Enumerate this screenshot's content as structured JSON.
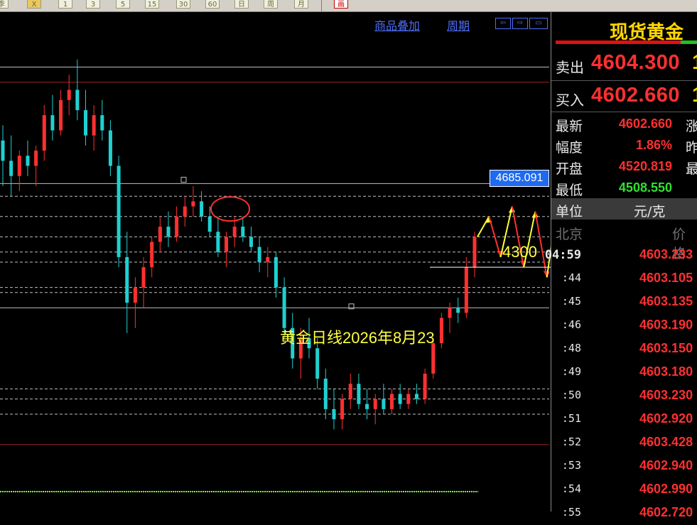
{
  "toolbar": {
    "buttons": [
      {
        "icon": "weekly-icon",
        "label": "季"
      },
      {
        "icon": "x-icon",
        "label": "X"
      },
      {
        "icon": "period-1-icon",
        "label": "1"
      },
      {
        "icon": "period-3-icon",
        "label": "3"
      },
      {
        "icon": "period-5-icon",
        "label": "5"
      },
      {
        "icon": "period-15-icon",
        "label": "15"
      },
      {
        "icon": "period-30-icon",
        "label": "30"
      },
      {
        "icon": "period-60-icon",
        "label": "60"
      },
      {
        "icon": "period-day-icon",
        "label": "日"
      },
      {
        "icon": "period-week-icon",
        "label": "周"
      },
      {
        "icon": "period-month-icon",
        "label": "月"
      },
      {
        "icon": "picture-icon",
        "label": "画"
      }
    ]
  },
  "chart_header": {
    "overlay_link": "商品叠加",
    "period_link": "周期",
    "nav_buttons": [
      "⇦",
      "⇨",
      "▭"
    ]
  },
  "chart_data": {
    "type": "candlestick",
    "title": "",
    "annotation_text": "黄金日线2026年8月23",
    "current_price_tag": "4685.091",
    "support_level_label": "4300",
    "ylim": [
      4100,
      5000
    ],
    "colors": {
      "up": "#ff3030",
      "down": "#20d0d0",
      "projection_up": "#ffff30",
      "projection_down": "#ff3030",
      "highlight_circle": "#ff3030"
    },
    "candles": [
      {
        "o": 4790,
        "h": 4820,
        "l": 4700,
        "c": 4750
      },
      {
        "o": 4750,
        "h": 4800,
        "l": 4680,
        "c": 4720
      },
      {
        "o": 4720,
        "h": 4770,
        "l": 4690,
        "c": 4760
      },
      {
        "o": 4760,
        "h": 4790,
        "l": 4720,
        "c": 4740
      },
      {
        "o": 4740,
        "h": 4780,
        "l": 4700,
        "c": 4770
      },
      {
        "o": 4770,
        "h": 4860,
        "l": 4750,
        "c": 4840
      },
      {
        "o": 4840,
        "h": 4880,
        "l": 4790,
        "c": 4810
      },
      {
        "o": 4810,
        "h": 4890,
        "l": 4800,
        "c": 4870
      },
      {
        "o": 4870,
        "h": 4920,
        "l": 4840,
        "c": 4890
      },
      {
        "o": 4890,
        "h": 4950,
        "l": 4830,
        "c": 4850
      },
      {
        "o": 4850,
        "h": 4890,
        "l": 4780,
        "c": 4800
      },
      {
        "o": 4800,
        "h": 4860,
        "l": 4770,
        "c": 4840
      },
      {
        "o": 4840,
        "h": 4870,
        "l": 4790,
        "c": 4810
      },
      {
        "o": 4810,
        "h": 4830,
        "l": 4720,
        "c": 4740
      },
      {
        "o": 4740,
        "h": 4760,
        "l": 4540,
        "c": 4560
      },
      {
        "o": 4560,
        "h": 4610,
        "l": 4410,
        "c": 4470
      },
      {
        "o": 4470,
        "h": 4520,
        "l": 4420,
        "c": 4500
      },
      {
        "o": 4500,
        "h": 4560,
        "l": 4460,
        "c": 4540
      },
      {
        "o": 4540,
        "h": 4600,
        "l": 4520,
        "c": 4590
      },
      {
        "o": 4590,
        "h": 4640,
        "l": 4570,
        "c": 4620
      },
      {
        "o": 4620,
        "h": 4650,
        "l": 4580,
        "c": 4600
      },
      {
        "o": 4600,
        "h": 4660,
        "l": 4590,
        "c": 4640
      },
      {
        "o": 4640,
        "h": 4680,
        "l": 4620,
        "c": 4660
      },
      {
        "o": 4660,
        "h": 4700,
        "l": 4640,
        "c": 4670
      },
      {
        "o": 4670,
        "h": 4690,
        "l": 4630,
        "c": 4640
      },
      {
        "o": 4640,
        "h": 4660,
        "l": 4600,
        "c": 4610
      },
      {
        "o": 4610,
        "h": 4640,
        "l": 4560,
        "c": 4570
      },
      {
        "o": 4570,
        "h": 4610,
        "l": 4540,
        "c": 4600
      },
      {
        "o": 4600,
        "h": 4640,
        "l": 4580,
        "c": 4620
      },
      {
        "o": 4620,
        "h": 4640,
        "l": 4590,
        "c": 4600
      },
      {
        "o": 4600,
        "h": 4620,
        "l": 4570,
        "c": 4580
      },
      {
        "o": 4580,
        "h": 4600,
        "l": 4530,
        "c": 4550
      },
      {
        "o": 4550,
        "h": 4580,
        "l": 4520,
        "c": 4560
      },
      {
        "o": 4560,
        "h": 4570,
        "l": 4480,
        "c": 4500
      },
      {
        "o": 4500,
        "h": 4520,
        "l": 4400,
        "c": 4420
      },
      {
        "o": 4420,
        "h": 4450,
        "l": 4340,
        "c": 4360
      },
      {
        "o": 4360,
        "h": 4420,
        "l": 4320,
        "c": 4400
      },
      {
        "o": 4400,
        "h": 4440,
        "l": 4360,
        "c": 4380
      },
      {
        "o": 4380,
        "h": 4400,
        "l": 4300,
        "c": 4320
      },
      {
        "o": 4320,
        "h": 4340,
        "l": 4240,
        "c": 4260
      },
      {
        "o": 4260,
        "h": 4300,
        "l": 4220,
        "c": 4240
      },
      {
        "o": 4240,
        "h": 4290,
        "l": 4220,
        "c": 4280
      },
      {
        "o": 4280,
        "h": 4330,
        "l": 4260,
        "c": 4310
      },
      {
        "o": 4310,
        "h": 4330,
        "l": 4260,
        "c": 4270
      },
      {
        "o": 4270,
        "h": 4300,
        "l": 4240,
        "c": 4260
      },
      {
        "o": 4260,
        "h": 4290,
        "l": 4230,
        "c": 4280
      },
      {
        "o": 4280,
        "h": 4310,
        "l": 4250,
        "c": 4260
      },
      {
        "o": 4260,
        "h": 4300,
        "l": 4250,
        "c": 4290
      },
      {
        "o": 4290,
        "h": 4310,
        "l": 4260,
        "c": 4270
      },
      {
        "o": 4270,
        "h": 4300,
        "l": 4260,
        "c": 4290
      },
      {
        "o": 4290,
        "h": 4310,
        "l": 4270,
        "c": 4280
      },
      {
        "o": 4280,
        "h": 4340,
        "l": 4270,
        "c": 4330
      },
      {
        "o": 4330,
        "h": 4400,
        "l": 4320,
        "c": 4390
      },
      {
        "o": 4390,
        "h": 4450,
        "l": 4380,
        "c": 4440
      },
      {
        "o": 4440,
        "h": 4470,
        "l": 4410,
        "c": 4460
      },
      {
        "o": 4460,
        "h": 4480,
        "l": 4430,
        "c": 4450
      },
      {
        "o": 4450,
        "h": 4560,
        "l": 4440,
        "c": 4540
      },
      {
        "o": 4540,
        "h": 4610,
        "l": 4520,
        "c": 4600
      }
    ],
    "projection_path": [
      4600,
      4640,
      4560,
      4660,
      4540,
      4650,
      4520,
      4680
    ],
    "horizontal_levels": [
      {
        "value": 4935,
        "style": "solid",
        "color": "#c0c0c0"
      },
      {
        "value": 4905,
        "style": "solid",
        "color": "#a02020"
      },
      {
        "value": 4705,
        "style": "solid",
        "color": "#c0c0c0"
      },
      {
        "value": 4680,
        "style": "dashed",
        "color": "#c0c0c0"
      },
      {
        "value": 4640,
        "style": "dashed",
        "color": "#c0c0c0"
      },
      {
        "value": 4600,
        "style": "dashed",
        "color": "#c0c0c0"
      },
      {
        "value": 4570,
        "style": "dashed",
        "color": "#c0c0c0"
      },
      {
        "value": 4550,
        "style": "dashed",
        "color": "#c0c0c0"
      },
      {
        "value": 4500,
        "style": "dashed",
        "color": "#c0c0c0"
      },
      {
        "value": 4490,
        "style": "dashed",
        "color": "#c0c0c0"
      },
      {
        "value": 4460,
        "style": "solid",
        "color": "#c0c0c0"
      },
      {
        "value": 4300,
        "style": "dashed",
        "color": "#c0c0c0"
      },
      {
        "value": 4280,
        "style": "dashed",
        "color": "#c0c0c0"
      },
      {
        "value": 4250,
        "style": "dashed",
        "color": "#c0c0c0"
      },
      {
        "value": 4190,
        "style": "solid",
        "color": "#a02020"
      }
    ]
  },
  "right_panel": {
    "title": "现货黄金",
    "sell": {
      "label": "卖出",
      "value": "4604.300",
      "tail": "1"
    },
    "buy": {
      "label": "买入",
      "value": "4602.660",
      "tail": "1"
    },
    "stats": [
      {
        "label": "最新",
        "value": "4602.660",
        "color": "#ff3030",
        "label2": "涨"
      },
      {
        "label": "幅度",
        "value": "1.86%",
        "color": "#ff3030",
        "label2": "昨"
      },
      {
        "label": "开盘",
        "value": "4520.819",
        "color": "#ff3030",
        "label2": "最"
      },
      {
        "label": "最低",
        "value": "4508.550",
        "color": "#30e030",
        "label2": ""
      }
    ],
    "unit": {
      "label": "单位",
      "value": "元/克"
    },
    "ticks_header": {
      "location": "北京",
      "price": "价格"
    },
    "ticks": [
      {
        "time": "04:59",
        "price": "4603.233"
      },
      {
        "time": ":44",
        "price": "4603.105"
      },
      {
        "time": ":45",
        "price": "4603.135"
      },
      {
        "time": ":46",
        "price": "4603.190"
      },
      {
        "time": ":48",
        "price": "4603.150"
      },
      {
        "time": ":49",
        "price": "4603.180"
      },
      {
        "time": ":50",
        "price": "4603.230"
      },
      {
        "time": ":51",
        "price": "4602.920"
      },
      {
        "time": ":52",
        "price": "4603.428"
      },
      {
        "time": ":53",
        "price": "4602.940"
      },
      {
        "time": ":54",
        "price": "4602.990"
      },
      {
        "time": ":55",
        "price": "4602.720"
      }
    ]
  }
}
